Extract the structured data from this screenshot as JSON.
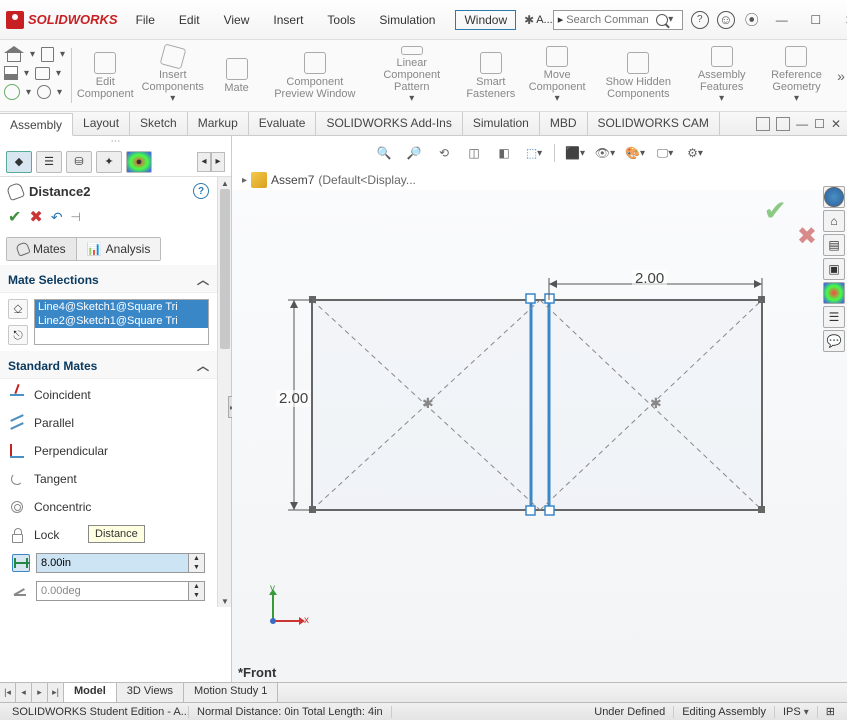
{
  "app": {
    "logo_text": "SOLIDWORKS",
    "title_letter": "A...",
    "search_placeholder": "Search Comman"
  },
  "menu": [
    "File",
    "Edit",
    "View",
    "Insert",
    "Tools",
    "Simulation",
    "Window"
  ],
  "ribbon_groups": [
    "Edit Component",
    "Insert Components",
    "Mate",
    "Component Preview Window",
    "Linear Component Pattern",
    "Smart Fasteners",
    "Move Component",
    "Show Hidden Components",
    "Assembly Features",
    "Reference Geometry"
  ],
  "tabs": [
    "Assembly",
    "Layout",
    "Sketch",
    "Markup",
    "Evaluate",
    "SOLIDWORKS Add-Ins",
    "Simulation",
    "MBD",
    "SOLIDWORKS CAM"
  ],
  "active_tab_index": 0,
  "property": {
    "name": "Distance2",
    "mates_tab": "Mates",
    "analysis_tab": "Analysis",
    "mate_selections_head": "Mate Selections",
    "selections": [
      "Line4@Sketch1@Square Tri",
      "Line2@Sketch1@Square Tri"
    ],
    "standard_mates_head": "Standard Mates",
    "mates": {
      "coincident": "Coincident",
      "parallel": "Parallel",
      "perpendicular": "Perpendicular",
      "tangent": "Tangent",
      "concentric": "Concentric",
      "lock": "Lock"
    },
    "tooltip": "Distance",
    "distance_value": "8.00in",
    "angle_value": "0.00deg"
  },
  "breadcrumb": {
    "doc": "Assem7",
    "suffix": "(Default<Display..."
  },
  "drawing": {
    "dim_h": "2.00",
    "dim_v": "2.00"
  },
  "triad": {
    "y": "y",
    "x": "x"
  },
  "view_label": "*Front",
  "bottom_tabs": [
    "Model",
    "3D Views",
    "Motion Study 1"
  ],
  "status": {
    "left1": "SOLIDWORKS Student Edition - A...",
    "left2": "Normal Distance: 0in Total Length: 4in",
    "mid1": "Under Defined",
    "mid2": "Editing Assembly",
    "units": "IPS"
  }
}
